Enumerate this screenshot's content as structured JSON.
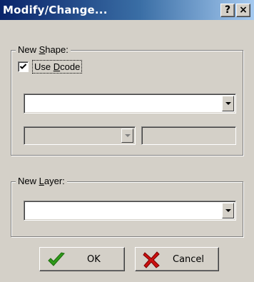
{
  "window": {
    "title": "Modify/Change...",
    "help_label": "?",
    "close_label": "×"
  },
  "new_shape": {
    "legend_pre": "New ",
    "legend_mnemonic": "S",
    "legend_post": "hape:",
    "use_dcode": {
      "label_pre": "Use ",
      "label_mnemonic": "D",
      "label_post": "code",
      "checked": true
    },
    "shape_combo_value": "",
    "dcode_combo_value": "",
    "dcode_text_value": ""
  },
  "new_layer": {
    "legend_pre": "New ",
    "legend_mnemonic": "L",
    "legend_post": "ayer:",
    "layer_combo_value": ""
  },
  "buttons": {
    "ok_label": "OK",
    "cancel_label": "Cancel"
  },
  "icons": {
    "ok": "green-checkmark-icon",
    "cancel": "red-x-icon",
    "ok_color": "#2e9a1a",
    "cancel_color": "#cc1010"
  }
}
